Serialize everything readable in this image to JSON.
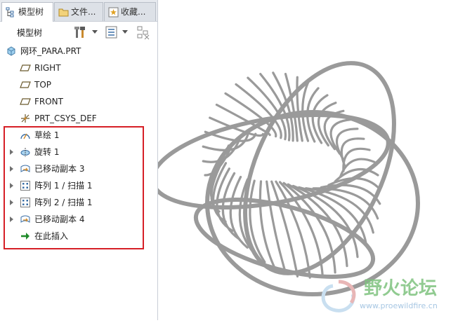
{
  "tabs": [
    {
      "label": "模型树",
      "icon": "model-tree-icon",
      "active": true
    },
    {
      "label": "文件...",
      "icon": "folder-icon",
      "active": false
    },
    {
      "label": "收藏...",
      "icon": "favorites-icon",
      "active": false
    }
  ],
  "toolbar": {
    "title": "模型树",
    "settings_icon": "tools-icon",
    "show_icon": "list-icon",
    "filter_icon": "filter-icon"
  },
  "tree": {
    "root": {
      "label": "网环_PARA.PRT",
      "icon": "part-icon"
    },
    "items": [
      {
        "label": "RIGHT",
        "icon": "datum-plane-icon",
        "expandable": false
      },
      {
        "label": "TOP",
        "icon": "datum-plane-icon",
        "expandable": false
      },
      {
        "label": "FRONT",
        "icon": "datum-plane-icon",
        "expandable": false
      },
      {
        "label": "PRT_CSYS_DEF",
        "icon": "coordinate-system-icon",
        "expandable": false
      },
      {
        "label": "草绘 1",
        "icon": "sketch-icon",
        "expandable": false
      },
      {
        "label": "旋转 1",
        "icon": "revolve-icon",
        "expandable": true
      },
      {
        "label": "已移动副本 3",
        "icon": "moved-copy-icon",
        "expandable": true
      },
      {
        "label": "阵列 1 / 扫描 1",
        "icon": "pattern-icon",
        "expandable": true
      },
      {
        "label": "阵列 2 / 扫描 1",
        "icon": "pattern-icon",
        "expandable": true
      },
      {
        "label": "已移动副本 4",
        "icon": "moved-copy-icon",
        "expandable": true
      },
      {
        "label": "在此插入",
        "icon": "insert-here-arrow-icon",
        "expandable": false
      }
    ]
  },
  "watermark": {
    "title": "野火论坛",
    "url": "www.proewildfire.cn"
  },
  "colors": {
    "highlight": "#d61f26",
    "model": "#9a9a9a",
    "watermark": "#7ec27e"
  }
}
